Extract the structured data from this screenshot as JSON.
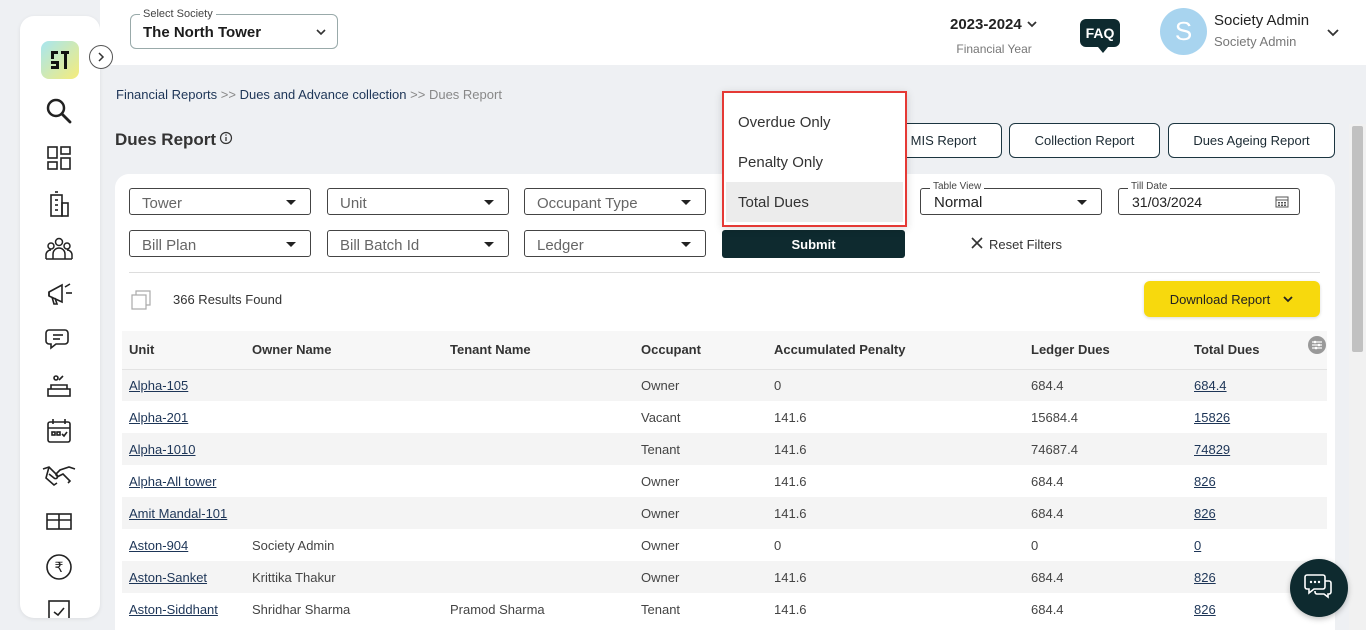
{
  "topbar": {
    "society_legend": "Select Society",
    "society_value": "The North Tower",
    "financial_year": "2023-2024",
    "financial_year_label": "Financial Year",
    "faq_label": "FAQ",
    "avatar_initial": "S",
    "user_name": "Society Admin",
    "user_role": "Society Admin"
  },
  "sidebar": {
    "icons": [
      "app-logo",
      "search-icon",
      "dashboard-icon",
      "building-icon",
      "members-icon",
      "announcement-icon",
      "chat-icon",
      "facility-icon",
      "calendar-icon",
      "handshake-icon",
      "gift-icon",
      "rupee-icon"
    ]
  },
  "breadcrumb": {
    "item1": "Financial Reports",
    "sep1": " >> ",
    "item2": "Dues and Advance collection",
    "sep2": " >> ",
    "current": "Dues Report"
  },
  "page": {
    "title": "Dues Report"
  },
  "report_buttons": {
    "mis": "MIS Report",
    "collection": "Collection Report",
    "ageing": "Dues Ageing Report"
  },
  "filters": {
    "tower": "Tower",
    "unit": "Unit",
    "occupant_type": "Occupant Type",
    "bill_plan": "Bill Plan",
    "bill_batch_id": "Bill Batch Id",
    "ledger": "Ledger",
    "table_view_legend": "Table View",
    "table_view_value": "Normal",
    "till_date_legend": "Till Date",
    "till_date_value": "31/03/2024",
    "submit": "Submit",
    "reset": "Reset Filters"
  },
  "results": {
    "text": "366 Results Found",
    "download": "Download Report"
  },
  "dues_dropdown": {
    "options": [
      "Overdue Only",
      "Penalty Only",
      "Total Dues"
    ],
    "selected": "Total Dues"
  },
  "table": {
    "headers": [
      "Unit",
      "Owner Name",
      "Tenant Name",
      "Occupant",
      "Accumulated Penalty",
      "Ledger Dues",
      "Total Dues"
    ],
    "rows": [
      [
        "Alpha-105",
        "",
        "",
        "Owner",
        "0",
        "684.4",
        "684.4"
      ],
      [
        "Alpha-201",
        "",
        "",
        "Vacant",
        "141.6",
        "15684.4",
        "15826"
      ],
      [
        "Alpha-1010",
        "",
        "",
        "Tenant",
        "141.6",
        "74687.4",
        "74829"
      ],
      [
        "Alpha-All tower",
        "",
        "",
        "Owner",
        "141.6",
        "684.4",
        "826"
      ],
      [
        "Amit Mandal-101",
        "",
        "",
        "Owner",
        "141.6",
        "684.4",
        "826"
      ],
      [
        "Aston-904",
        "Society Admin",
        "",
        "Owner",
        "0",
        "0",
        "0"
      ],
      [
        "Aston-Sanket",
        "Krittika Thakur",
        "",
        "Owner",
        "141.6",
        "684.4",
        "826"
      ],
      [
        "Aston-Siddhant",
        "Shridhar Sharma",
        "Pramod Sharma",
        "Tenant",
        "141.6",
        "684.4",
        "826"
      ]
    ]
  },
  "colors": {
    "primary_dark": "#0e2a2f",
    "accent_yellow": "#f7d90d",
    "highlight_red": "#e53935"
  }
}
